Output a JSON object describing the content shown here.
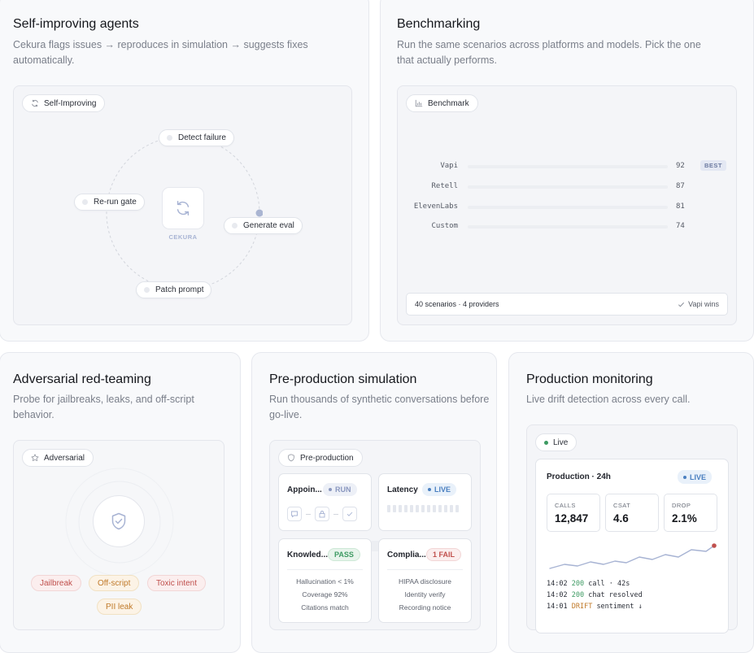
{
  "self_improving": {
    "title": "Self-improving agents",
    "description_line1": "Cekura flags issues → reproduces in simulation → suggests fixes",
    "description_line2": "automatically.",
    "chip": "Self-Improving",
    "center_label": "CEKURA",
    "nodes": [
      "Detect failure",
      "Generate eval",
      "Patch prompt",
      "Re-run gate"
    ]
  },
  "benchmarking": {
    "title": "Benchmarking",
    "description_line1": "Run the same scenarios across platforms and models. Pick the one",
    "description_line2": "that actually performs.",
    "chip": "Benchmark",
    "rows": [
      {
        "label": "Vapi",
        "value": "92"
      },
      {
        "label": "Retell",
        "value": "87"
      },
      {
        "label": "ElevenLabs",
        "value": "81"
      },
      {
        "label": "Custom",
        "value": "74"
      }
    ],
    "best_badge": "BEST",
    "footer_left": "40 scenarios · 4 providers",
    "footer_right": "Vapi wins"
  },
  "adversarial": {
    "title": "Adversarial red-teaming",
    "description_line1": "Probe for jailbreaks, leaks, and off-script",
    "description_line2": "behavior.",
    "chip": "Adversarial",
    "tags": [
      "Jailbreak",
      "Off-script",
      "Toxic intent",
      "PII leak"
    ]
  },
  "preproduction": {
    "title": "Pre-production simulation",
    "description_line1": "Run thousands of synthetic conversations before",
    "description_line2": "go-live.",
    "chip": "Pre-production",
    "cards": [
      {
        "title": "Appoin...",
        "status": "RUN"
      },
      {
        "title": "Latency",
        "status": "LIVE"
      },
      {
        "title": "Knowled...",
        "status": "PASS",
        "checks": [
          "Hallucination < 1%",
          "Coverage 92%",
          "Citations match"
        ]
      },
      {
        "title": "Complia...",
        "status": "1 FAIL",
        "checks": [
          "HIPAA disclosure",
          "Identity verify",
          "Recording notice"
        ]
      }
    ]
  },
  "monitoring": {
    "title": "Production monitoring",
    "description": "Live drift detection across every call.",
    "chip": "Live",
    "panel_title": "Production · 24h",
    "panel_badge": "LIVE",
    "metrics": [
      {
        "label": "CALLS",
        "value": "12,847"
      },
      {
        "label": "CSAT",
        "value": "4.6"
      },
      {
        "label": "DROP",
        "value": "2.1%"
      }
    ],
    "logs": [
      {
        "time": "14:02",
        "code": "200",
        "text": "call · 42s"
      },
      {
        "time": "14:02",
        "code": "200",
        "text": "chat resolved"
      },
      {
        "time": "14:01",
        "code": "DRIFT",
        "text": "sentiment ↓"
      }
    ]
  },
  "colors": {
    "accent_blue": "#4a7fc0",
    "pass_green": "#3d9a62",
    "fail_red": "#c0504d",
    "drift_orange": "#c07a2a"
  }
}
